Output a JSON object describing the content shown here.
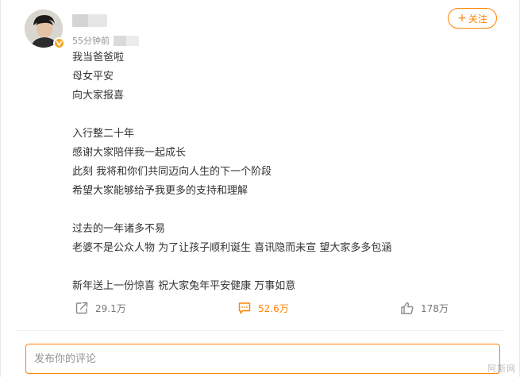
{
  "author": {
    "avatar_icon": "person-avatar-photo",
    "verified_badge_icon": "verified-v-icon",
    "time": "55分钟前"
  },
  "follow_button": {
    "plus": "+",
    "label": "关注"
  },
  "post": {
    "lines": [
      "我当爸爸啦",
      "母女平安",
      "向大家报喜",
      "",
      "入行整二十年",
      "感谢大家陪伴我一起成长",
      "此刻 我将和你们共同迈向人生的下一个阶段",
      "希望大家能够给予我更多的支持和理解",
      "",
      "过去的一年诸多不易",
      "老婆不是公众人物 为了让孩子顺利诞生 喜讯隐而未宣 望大家多多包涵",
      "",
      "新年送上一份惊喜 祝大家兔年平安健康 万事如意"
    ]
  },
  "actions": {
    "repost": {
      "icon": "share-icon",
      "count": "29.1万"
    },
    "comment": {
      "icon": "comment-icon",
      "count": "52.6万"
    },
    "like": {
      "icon": "thumbs-up-icon",
      "count": "178万"
    }
  },
  "comment_input": {
    "placeholder": "发布你的评论"
  },
  "watermark": "阿斯网",
  "colors": {
    "accent": "#ff8200",
    "text": "#333333",
    "muted": "#939393"
  }
}
